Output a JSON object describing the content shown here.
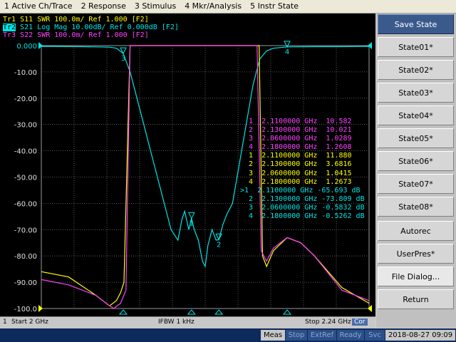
{
  "menu": {
    "items": [
      "1 Active Ch/Trace",
      "2 Response",
      "3 Stimulus",
      "4 Mkr/Analysis",
      "5 Instr State"
    ]
  },
  "traces": [
    {
      "id": "Tr1",
      "param": "S11",
      "text": "SWR 100.0m/ Ref 1.000 [F2]",
      "color": "#ffff00"
    },
    {
      "id": "Tr2",
      "param": "S21",
      "text": "Log Mag 10.00dB/ Ref 0.000dB [F2]",
      "color": "#00e5e5"
    },
    {
      "id": "Tr3",
      "param": "S22",
      "text": "SWR 100.0m/ Ref 1.000 [F2]",
      "color": "#ff40ff"
    }
  ],
  "chart_data": {
    "type": "line",
    "xlabel": "",
    "ylabel": "",
    "xlim": [
      2.0,
      2.24
    ],
    "ylim": [
      -100,
      0
    ],
    "y_ticks": [
      "0.000",
      "-10.00",
      "-20.00",
      "-30.00",
      "-40.00",
      "-50.00",
      "-60.00",
      "-70.00",
      "-80.00",
      "-90.00",
      "-100.0"
    ],
    "grid": true,
    "series": [
      {
        "name": "S21",
        "color": "#00e5e5",
        "x": [
          2.0,
          2.03,
          2.05,
          2.055,
          2.06,
          2.065,
          2.07,
          2.075,
          2.08,
          2.085,
          2.09,
          2.095,
          2.1,
          2.103,
          2.105,
          2.108,
          2.11,
          2.112,
          2.115,
          2.118,
          2.12,
          2.122,
          2.125,
          2.128,
          2.13,
          2.133,
          2.136,
          2.14,
          2.145,
          2.15,
          2.155,
          2.16,
          2.165,
          2.17,
          2.18,
          2.2,
          2.22,
          2.24
        ],
        "y": [
          -0.3,
          -0.4,
          -0.6,
          -1.0,
          -3.0,
          -10.0,
          -20.0,
          -30.0,
          -40.0,
          -50.0,
          -60.0,
          -70.0,
          -74.0,
          -66.0,
          -63.0,
          -70.0,
          -65.7,
          -70.0,
          -74.0,
          -82.0,
          -84.0,
          -76.0,
          -70.0,
          -74.0,
          -73.8,
          -68.0,
          -64.0,
          -60.0,
          -45.0,
          -30.0,
          -15.0,
          -5.0,
          -2.0,
          -1.0,
          -0.5,
          -0.4,
          -0.4,
          -0.3
        ]
      },
      {
        "name": "S11",
        "color": "#ffff00",
        "x": [
          2.0,
          2.02,
          2.04,
          2.05,
          2.055,
          2.058,
          2.0605,
          2.065,
          2.1,
          2.14,
          2.1595,
          2.162,
          2.165,
          2.17,
          2.18,
          2.19,
          2.2,
          2.22,
          2.24
        ],
        "y": [
          -86.0,
          -88.0,
          -95.0,
          -99.0,
          -97.0,
          -94.0,
          -90.0,
          0.0,
          0.0,
          0.0,
          0.0,
          -80.0,
          -84.0,
          -78.0,
          -73.0,
          -75.0,
          -80.0,
          -92.0,
          -98.0
        ],
        "marker_values": [
          "11.880",
          "3.6816",
          "1.0415",
          "1.2673"
        ]
      },
      {
        "name": "S22",
        "color": "#ff40ff",
        "x": [
          2.0,
          2.02,
          2.04,
          2.05,
          2.053,
          2.058,
          2.062,
          2.065,
          2.1,
          2.14,
          2.158,
          2.161,
          2.165,
          2.17,
          2.18,
          2.19,
          2.2,
          2.22,
          2.24
        ],
        "y": [
          -89.0,
          -91.0,
          -95.0,
          -99.0,
          -100.0,
          -98.0,
          -93.0,
          0.0,
          0.0,
          0.0,
          0.0,
          -78.0,
          -82.0,
          -77.0,
          -73.0,
          -75.0,
          -80.0,
          -93.0,
          -97.0
        ],
        "marker_values": [
          "10.582",
          "10.021",
          "1.0289",
          "1.2608"
        ]
      }
    ],
    "markers": [
      {
        "num": "1",
        "freq": "2.1100000 GHz",
        "x": 2.11
      },
      {
        "num": "2",
        "freq": "2.1300000 GHz",
        "x": 2.13
      },
      {
        "num": "3",
        "freq": "2.0600000 GHz",
        "x": 2.06
      },
      {
        "num": "4",
        "freq": "2.1800000 GHz",
        "x": 2.18
      }
    ]
  },
  "marker_table": [
    {
      "color": "#ff40ff",
      "text": "  1  2.1100000 GHz  10.582"
    },
    {
      "color": "#ff40ff",
      "text": "  2  2.1300000 GHz  10.021"
    },
    {
      "color": "#ff40ff",
      "text": "  3  2.0600000 GHz  1.0289"
    },
    {
      "color": "#ff40ff",
      "text": "  4  2.1800000 GHz  1.2608"
    },
    {
      "color": "#ffff00",
      "text": "  1  2.1100000 GHz  11.880"
    },
    {
      "color": "#ffff00",
      "text": "  2  2.1300000 GHz  3.6816"
    },
    {
      "color": "#ffff00",
      "text": "  3  2.0600000 GHz  1.0415"
    },
    {
      "color": "#ffff00",
      "text": "  4  2.1800000 GHz  1.2673"
    },
    {
      "color": "#00e5e5",
      "text": ">1  2.1100000 GHz -65.693 dB"
    },
    {
      "color": "#00e5e5",
      "text": "  2  2.1300000 GHz -73.809 dB"
    },
    {
      "color": "#00e5e5",
      "text": "  3  2.0600000 GHz -0.5832 dB"
    },
    {
      "color": "#00e5e5",
      "text": "  4  2.1800000 GHz -0.5262 dB"
    }
  ],
  "status": {
    "channel": "1",
    "start": "Start 2 GHz",
    "ifbw": "IFBW 1 kHz",
    "stop": "Stop 2.24 GHz",
    "cor": "Cor"
  },
  "sidebar": {
    "buttons": [
      "Save State",
      "State01*",
      "State02*",
      "State03*",
      "State04*",
      "State05*",
      "State06*",
      "State07*",
      "State08*",
      "Autorec",
      "UserPres*",
      "File Dialog...",
      "Return"
    ]
  },
  "bottom": {
    "meas": "Meas",
    "stop": "Stop",
    "extref": "ExtRef",
    "ready": "Ready",
    "svc": "Svc",
    "datetime": "2018-08-27 09:09"
  }
}
